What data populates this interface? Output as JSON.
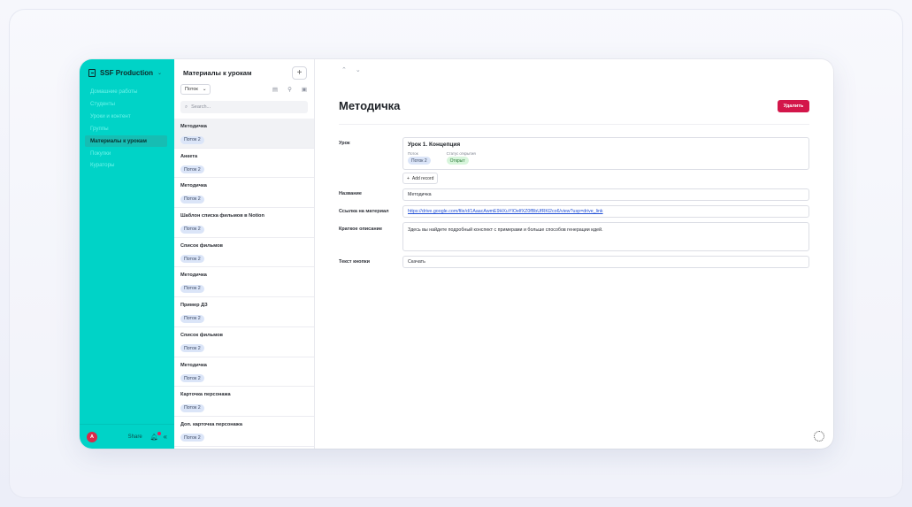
{
  "sidebar": {
    "workspace": "SSF Production",
    "items": [
      {
        "label": "Домашние работы"
      },
      {
        "label": "Студенты"
      },
      {
        "label": "Уроки и контент"
      },
      {
        "label": "Группы"
      },
      {
        "label": "Материалы к урокам"
      },
      {
        "label": "Покупки"
      },
      {
        "label": "Кураторы"
      }
    ],
    "active_index": 4,
    "footer": {
      "avatar_letter": "A",
      "share_label": "Share"
    }
  },
  "list": {
    "title": "Материалы к урокам",
    "add_label": "+",
    "filter_label": "Поток",
    "search_placeholder": "Search...",
    "records": [
      {
        "title": "Методичка",
        "tag": "Поток 2"
      },
      {
        "title": "Анкета",
        "tag": "Поток 2"
      },
      {
        "title": "Методичка",
        "tag": "Поток 2"
      },
      {
        "title": "Шаблон списка фильмов в Notion",
        "tag": "Поток 2"
      },
      {
        "title": "Список фильмов",
        "tag": "Поток 2"
      },
      {
        "title": "Методичка",
        "tag": "Поток 2"
      },
      {
        "title": "Пример ДЗ",
        "tag": "Поток 2"
      },
      {
        "title": "Список фильмов",
        "tag": "Поток 2"
      },
      {
        "title": "Методичка",
        "tag": "Поток 2"
      },
      {
        "title": "Карточка персонажа",
        "tag": "Поток 2"
      },
      {
        "title": "Доп. карточка персонажа",
        "tag": "Поток 2"
      }
    ],
    "selected_index": 0
  },
  "detail": {
    "title": "Методичка",
    "delete_label": "Удалить",
    "fields": {
      "lesson_label": "Урок",
      "lesson": {
        "title": "Урок 1. Концепция",
        "stream_label": "Поток",
        "stream_value": "Поток 2",
        "status_label": "Статус открытия",
        "status_value": "Открыт"
      },
      "add_record_label": "Add record",
      "name_label": "Название",
      "name_value": "Методичка",
      "link_label": "Ссылка на материал",
      "link_value": "https://drive.google.com/file/d/1AaacAwmE9HXuYIOelfXZ0fBbUfRKl2co6/view?usp=drive_link",
      "desc_label": "Краткое описание",
      "desc_value": "Здесь вы найдете подробный конспект с примерами и больше способов генерации идей.",
      "button_text_label": "Текст кнопки",
      "button_text_value": "Скачать"
    }
  },
  "colors": {
    "sidebar": "#00d3c7",
    "danger": "#d3164a",
    "tag_blue": "#dbe5f8",
    "tag_green": "#d8f5dc"
  }
}
